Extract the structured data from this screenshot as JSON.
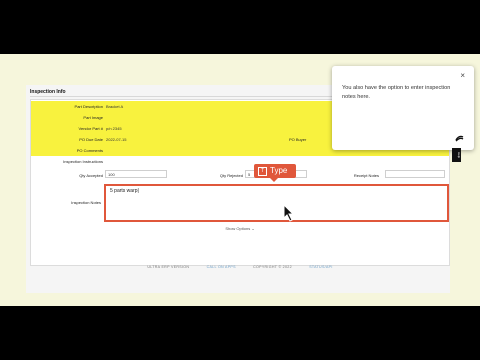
{
  "panel": {
    "title": "Inspection Info",
    "rows": [
      {
        "label": "Part Description",
        "value": "Bracket A"
      },
      {
        "label": "Part Image",
        "value": ""
      },
      {
        "label": "Vendor Part #",
        "value": "p/n 2345"
      },
      {
        "label": "PO Due Date",
        "value": "2022-07-15",
        "label2": "PO Buyer"
      },
      {
        "label": "PO Comments",
        "value": ""
      },
      {
        "label": "Inspection Instructions",
        "value": ""
      }
    ],
    "qty_accepted_label": "Qty Accepted",
    "qty_accepted_value": "100",
    "qty_rejected_label": "Qty Rejected",
    "qty_rejected_value": "5",
    "receipt_notes_label": "Receipt Notes",
    "inspection_notes_label": "Inspection Notes",
    "inspection_notes_value": "5 parts warp|",
    "show_options": "Show Options ⌄"
  },
  "type_badge": {
    "key": "T",
    "label": "Type"
  },
  "footer": {
    "version": "ULTRA ERP VERSION",
    "company": "CALL ON APPS",
    "copyright": "COPYRIGHT © 2022",
    "link": "STATUS/API"
  },
  "tooltip": {
    "text": "You also have the option to enter inspection notes here.",
    "close": "×"
  },
  "side_tab": "Help",
  "colors": {
    "highlight": "#f8f23e",
    "accent": "#e0573b",
    "background": "#f6f6dc"
  }
}
